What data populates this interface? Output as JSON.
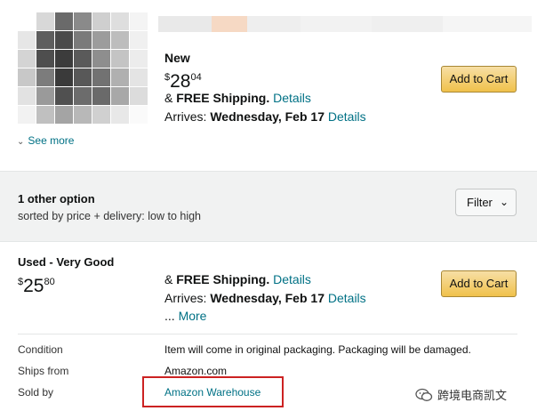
{
  "offer_new": {
    "condition": "New",
    "price_symbol": "$",
    "price_whole": "28",
    "price_fraction": "04",
    "shipping_prefix": "& ",
    "shipping_label": "FREE Shipping.",
    "details_link": "Details",
    "arrives_label": "Arrives: ",
    "arrives_date": "Wednesday, Feb 17",
    "add_to_cart": "Add to Cart"
  },
  "see_more": "See more",
  "options": {
    "count_label": "1 other option",
    "sort_label": "sorted by price + delivery: low to high",
    "filter_label": "Filter"
  },
  "offer_used": {
    "condition": "Used - Very Good",
    "price_symbol": "$",
    "price_whole": "25",
    "price_fraction": "80",
    "shipping_prefix": "& ",
    "shipping_label": "FREE Shipping.",
    "details_link": "Details",
    "arrives_label": "Arrives: ",
    "arrives_date": "Wednesday, Feb 17",
    "more_prefix": "... ",
    "more_link": "More",
    "add_to_cart": "Add to Cart"
  },
  "details": {
    "condition_label": "Condition",
    "condition_value": "Item will come in original packaging. Packaging will be damaged.",
    "ships_from_label": "Ships from",
    "ships_from_value": "Amazon.com",
    "sold_by_label": "Sold by",
    "sold_by_value": "Amazon Warehouse"
  },
  "watermark": {
    "text": "跨境电商凯文"
  },
  "colors": {
    "link": "#007185",
    "cart_button": "#f0c14b",
    "highlight": "#cc2222",
    "band": "#f1f2f2"
  }
}
